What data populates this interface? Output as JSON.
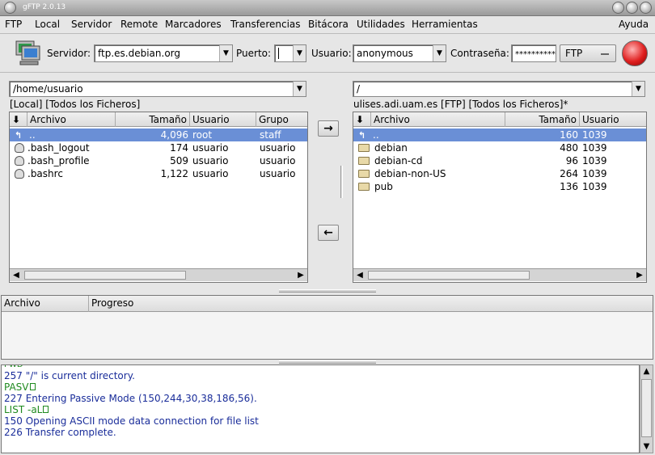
{
  "window": {
    "title": "gFTP 2.0.13"
  },
  "menu": {
    "items": [
      "FTP",
      "Local",
      "Servidor",
      "Remote",
      "Marcadores",
      "Transferencias",
      "Bitácora",
      "Utilidades",
      "Herramientas",
      "Ayuda"
    ]
  },
  "toolbar": {
    "server_label": "Servidor:",
    "server_value": "ftp.es.debian.org",
    "port_label": "Puerto:",
    "port_value": "",
    "user_label": "Usuario:",
    "user_value": "anonymous",
    "password_label": "Contraseña:",
    "password_value": "**********",
    "protocol_value": "FTP"
  },
  "local": {
    "path": "/home/usuario",
    "status": "[Local] [Todos los Ficheros]",
    "columns": [
      "Archivo",
      "Tamaño",
      "Usuario",
      "Grupo"
    ],
    "rows": [
      {
        "name": "..",
        "size": "4,096",
        "user": "root",
        "group": "staff",
        "kind": "up"
      },
      {
        "name": ".bash_logout",
        "size": "174",
        "user": "usuario",
        "group": "usuario",
        "kind": "file"
      },
      {
        "name": ".bash_profile",
        "size": "509",
        "user": "usuario",
        "group": "usuario",
        "kind": "file"
      },
      {
        "name": ".bashrc",
        "size": "1,122",
        "user": "usuario",
        "group": "usuario",
        "kind": "file"
      }
    ]
  },
  "remote": {
    "path": "/",
    "status": "ulises.adi.uam.es [FTP] [Todos los Ficheros]*",
    "columns": [
      "Archivo",
      "Tamaño",
      "Usuario"
    ],
    "rows": [
      {
        "name": "..",
        "size": "160",
        "user": "1039",
        "kind": "up"
      },
      {
        "name": "debian",
        "size": "480",
        "user": "1039",
        "kind": "folder"
      },
      {
        "name": "debian-cd",
        "size": "96",
        "user": "1039",
        "kind": "folder"
      },
      {
        "name": "debian-non-US",
        "size": "264",
        "user": "1039",
        "kind": "folder"
      },
      {
        "name": "pub",
        "size": "136",
        "user": "1039",
        "kind": "folder"
      }
    ]
  },
  "transfers": {
    "columns": [
      "Archivo",
      "Progreso"
    ]
  },
  "log": {
    "lines": [
      {
        "text": "257 \"/\" is current directory.",
        "color": "blue"
      },
      {
        "text": "PASV",
        "color": "green"
      },
      {
        "text": "227 Entering Passive Mode (150,244,30,38,186,56).",
        "color": "blue"
      },
      {
        "text": "LIST -aL",
        "color": "green"
      },
      {
        "text": "150 Opening ASCII mode data connection for file list",
        "color": "blue"
      },
      {
        "text": "226 Transfer complete.",
        "color": "blue"
      }
    ]
  }
}
